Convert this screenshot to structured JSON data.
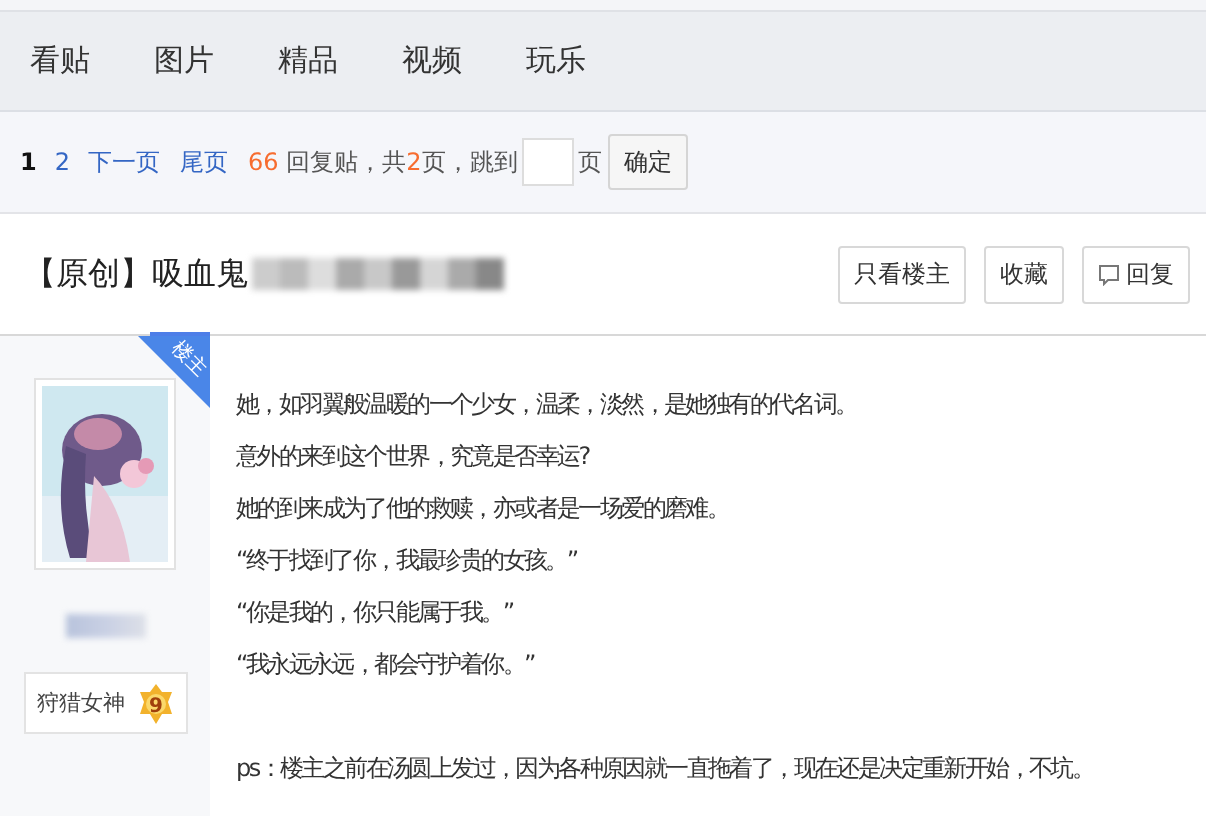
{
  "nav": {
    "tabs": [
      {
        "label": "看贴"
      },
      {
        "label": "图片"
      },
      {
        "label": "精品"
      },
      {
        "label": "视频"
      },
      {
        "label": "玩乐"
      }
    ]
  },
  "pager": {
    "pages": [
      {
        "label": "1",
        "selected": true
      },
      {
        "label": "2",
        "selected": false
      }
    ],
    "links": [
      "下一页",
      "尾页"
    ],
    "reply_count": "66",
    "reply_label": "回复贴，共",
    "page_count": "2",
    "page_label": "页，跳到",
    "jump_unit": "页",
    "confirm": "确定"
  },
  "thread": {
    "title": "【原创】吸血鬼",
    "buttons": [
      {
        "label": "只看楼主",
        "kind": "text"
      },
      {
        "label": "收藏",
        "kind": "text"
      },
      {
        "label": "回复",
        "kind": "reply"
      }
    ]
  },
  "post": {
    "author_badge": "楼主",
    "honor": {
      "title": "狩猎女神",
      "level": "9"
    },
    "paragraphs": [
      "她，如羽翼般温暖的一个少女，温柔，淡然，是她独有的代名词。",
      "意外的来到这个世界，究竟是否幸运?",
      "她的到来成为了他的救赎，亦或者是一场爱的磨难。",
      "“终于找到了你，我最珍贵的女孩。”",
      "“你是我的，你只能属于我。”",
      "“我永远永远，都会守护着你。”"
    ],
    "note": "ps：楼主之前在汤圆上发过，因为各种原因就一直拖着了，现在还是决定重新开始，不坑。"
  }
}
